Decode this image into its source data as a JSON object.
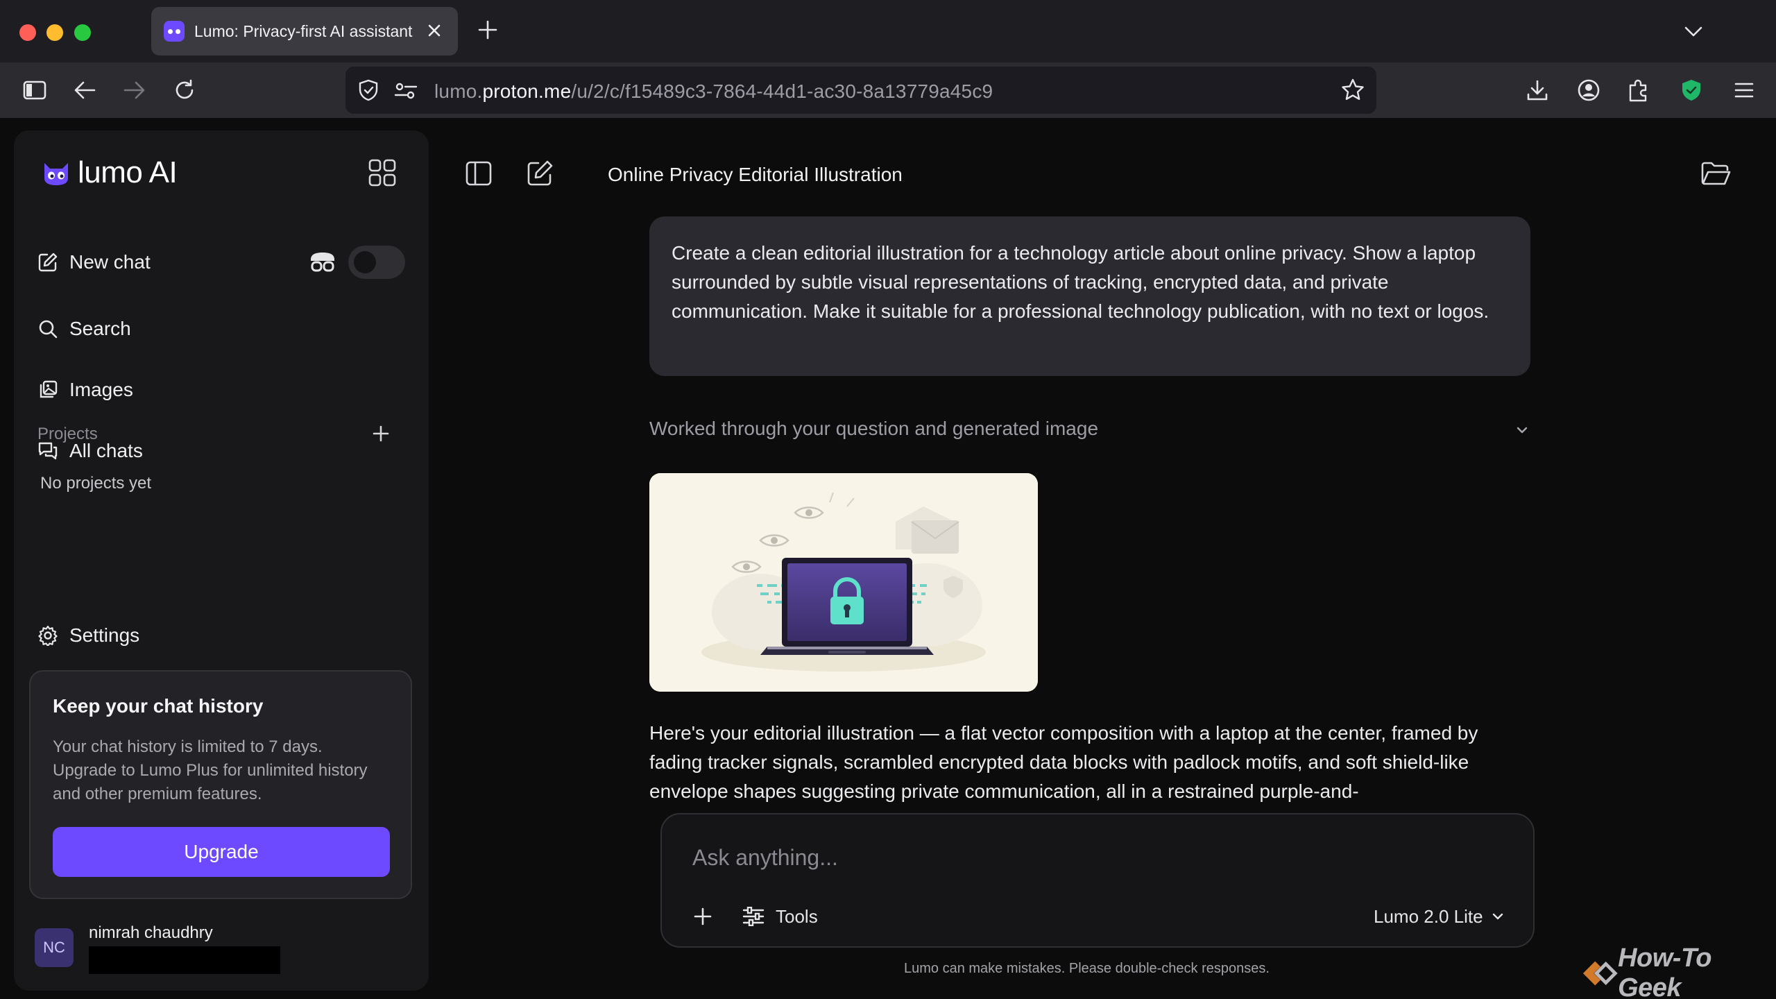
{
  "browser": {
    "tab_title": "Lumo: Privacy-first AI assistant",
    "url_prefix": "lumo.",
    "url_host": "proton.me",
    "url_path": "/u/2/c/f15489c3-7864-44d1-ac30-8a13779a45c9"
  },
  "sidebar": {
    "logo_text": "lumo AI",
    "new_chat": "New chat",
    "search": "Search",
    "images": "Images",
    "all_chats": "All chats",
    "projects_label": "Projects",
    "no_projects": "No projects yet",
    "settings": "Settings",
    "promo": {
      "title": "Keep your chat history",
      "body": "Your chat history is limited to 7 days. Upgrade to Lumo Plus for unlimited history and other premium features.",
      "button": "Upgrade"
    },
    "user": {
      "initials": "NC",
      "name": "nimrah chaudhry"
    }
  },
  "chat": {
    "title": "Online Privacy Editorial Illustration",
    "user_message": "Create a clean editorial illustration for a technology article about online privacy. Show a laptop surrounded by subtle visual representations of tracking, encrypted data, and private communication. Make it suitable for a professional technology publication, with no text or logos.",
    "worked_label": "Worked through your question and generated image",
    "reply": "Here's your editorial illustration — a flat vector composition with a laptop at the center, framed by fading tracker signals, scrambled encrypted data blocks with padlock motifs, and soft shield-like envelope shapes suggesting private communication, all in a restrained purple-and-"
  },
  "composer": {
    "placeholder": "Ask anything...",
    "tools_label": "Tools",
    "model_label": "Lumo 2.0 Lite",
    "disclaimer": "Lumo can make mistakes. Please double-check responses."
  },
  "watermark": {
    "text": "How-To Geek"
  },
  "colors": {
    "accent": "#6d4aff",
    "sidebar_bg": "#18181b",
    "app_bg": "#0c0c0d",
    "bubble_bg": "#2a2a30"
  }
}
